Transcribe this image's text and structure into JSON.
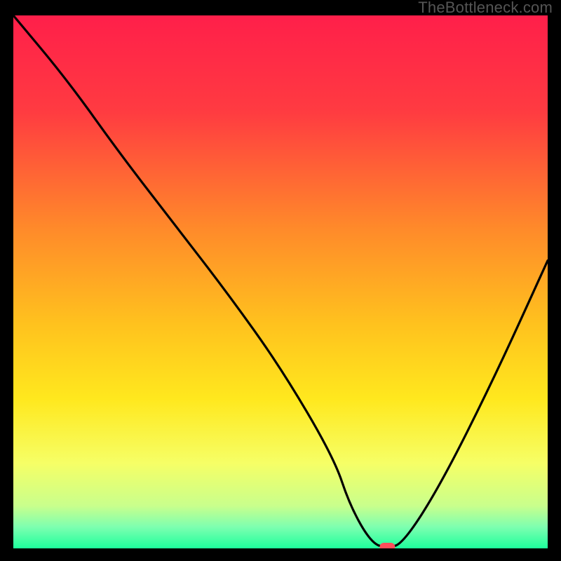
{
  "watermark": "TheBottleneck.com",
  "chart_data": {
    "type": "line",
    "title": "",
    "xlabel": "",
    "ylabel": "",
    "xlim": [
      0,
      100
    ],
    "ylim": [
      0,
      100
    ],
    "gradient_stops": [
      {
        "offset": 0,
        "color": "#ff1f4a"
      },
      {
        "offset": 18,
        "color": "#ff3b41"
      },
      {
        "offset": 40,
        "color": "#ff8a2a"
      },
      {
        "offset": 58,
        "color": "#ffc21e"
      },
      {
        "offset": 72,
        "color": "#ffe81e"
      },
      {
        "offset": 84,
        "color": "#f6ff66"
      },
      {
        "offset": 92,
        "color": "#c9ff8c"
      },
      {
        "offset": 96,
        "color": "#7dffb0"
      },
      {
        "offset": 100,
        "color": "#1dff9c"
      }
    ],
    "series": [
      {
        "name": "bottleneck-curve",
        "x": [
          0,
          10,
          20,
          30,
          40,
          50,
          60,
          63,
          67,
          70,
          73,
          80,
          90,
          100
        ],
        "y": [
          100,
          88,
          74,
          61,
          48,
          34,
          17,
          8,
          1,
          0,
          1,
          12,
          32,
          54
        ]
      }
    ],
    "marker": {
      "name": "optimal-point",
      "x": 70,
      "y": 0,
      "color": "#ff4d5a"
    }
  }
}
